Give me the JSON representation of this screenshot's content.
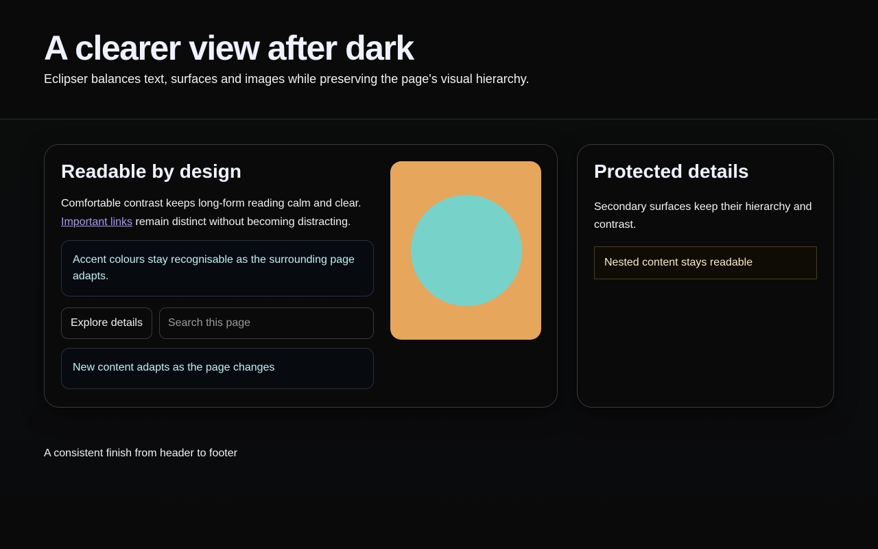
{
  "header": {
    "title": "A clearer view after dark",
    "subtitle": "Eclipser balances text, surfaces and images while preserving the page's visual hierarchy."
  },
  "main_card": {
    "title": "Readable by design",
    "intro_text": "Comfortable contrast keeps long-form reading calm and clear.",
    "link_text": "Important links",
    "after_link_text": " remain distinct without becoming distracting.",
    "accent_note": "Accent colours stay recognisable as the surrounding page adapts.",
    "explore_button": "Explore details",
    "search_placeholder": "Search this page",
    "dynamic_note": "New content adapts as the page changes",
    "illustration": {
      "background_color": "#e6a65c",
      "circle_color": "#77d3c9"
    }
  },
  "side_card": {
    "title": "Protected details",
    "text": "Secondary surfaces keep their hierarchy and contrast.",
    "nested_note": "Nested content stays readable"
  },
  "footer": {
    "text": "A consistent finish from header to footer"
  },
  "colors": {
    "background": "#0a0a0a",
    "link": "#a99bf3",
    "accent_text": "#bff0f5",
    "nested_text": "#fde8c4"
  }
}
